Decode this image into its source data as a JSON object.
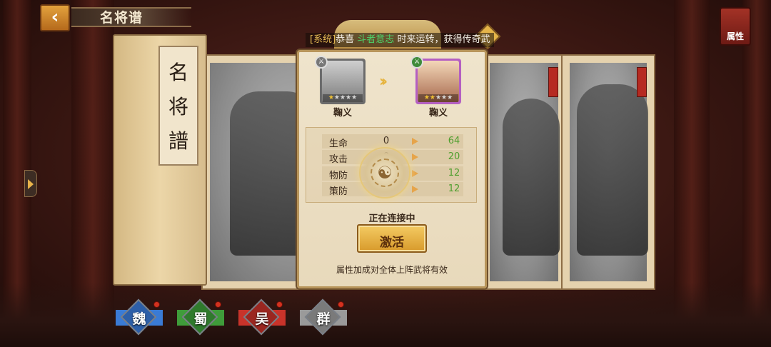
{
  "header": {
    "back_icon": "chevron-left-icon",
    "title": "名将谱"
  },
  "top_right": {
    "label": "属性",
    "icon": "book-icon"
  },
  "book": {
    "spine_title": [
      "名",
      "将",
      "譜"
    ]
  },
  "system_message": {
    "tag": "[系统]",
    "text_before": "恭喜 ",
    "highlight": "斗者意志",
    "text_after": " 时来运转，获得传奇武"
  },
  "modal": {
    "heroes": [
      {
        "name": "鞠义",
        "stars_filled": 1,
        "stars_total": 5,
        "frame_color": "#6b6b6b"
      },
      {
        "name": "鞠义",
        "stars_filled": 2,
        "stars_total": 5,
        "frame_color": "#b45fc2"
      }
    ],
    "stats": [
      {
        "label": "生命",
        "from": "0",
        "to": "64"
      },
      {
        "label": "攻击",
        "from": "0",
        "to": "20"
      },
      {
        "label": "物防",
        "from": "0",
        "to": "12"
      },
      {
        "label": "策防",
        "from": "0",
        "to": "12"
      }
    ],
    "connecting_text": "正在连接中",
    "activate_label": "激活",
    "footer_note": "属性加成对全体上阵武将有效"
  },
  "factions": [
    {
      "label": "魏",
      "color": "#3a7bd5"
    },
    {
      "label": "蜀",
      "color": "#3f9c3a"
    },
    {
      "label": "吴",
      "color": "#c8332a"
    },
    {
      "label": "群",
      "color": "#9a9a9a"
    }
  ],
  "colors": {
    "accent_gold": "#e6b43f",
    "stat_gain_green": "#4f9f2e",
    "system_highlight": "#4ed36a"
  }
}
